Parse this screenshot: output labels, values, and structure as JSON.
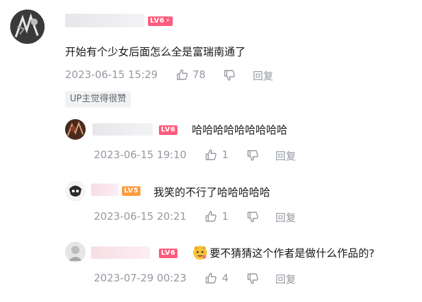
{
  "root": {
    "level_badge": "LV6",
    "text": "开始有个少女后面怎么全是富瑞南通了",
    "time": "2023-06-15 15:29",
    "likes": "78",
    "reply_label": "回复",
    "up_tag": "UP主觉得很赞"
  },
  "replies": [
    {
      "level_badge": "LV6",
      "text": "哈哈哈哈哈哈哈哈哈",
      "time": "2023-06-15 19:10",
      "likes": "1",
      "reply_label": "回复"
    },
    {
      "level_badge": "LV5",
      "text": "我笑的不行了哈哈哈哈哈",
      "time": "2023-06-15 20:21",
      "likes": "1",
      "reply_label": "回复"
    },
    {
      "level_badge": "LV6",
      "text": "要不猜猜这个作者是做什么作品的?",
      "time": "2023-07-29 00:23",
      "likes": "4",
      "reply_label": "回复"
    }
  ],
  "colors": {
    "lv6": "#ff5c7c",
    "lv5": "#ff9a3c",
    "meta": "#9499a0",
    "text": "#18191c"
  }
}
